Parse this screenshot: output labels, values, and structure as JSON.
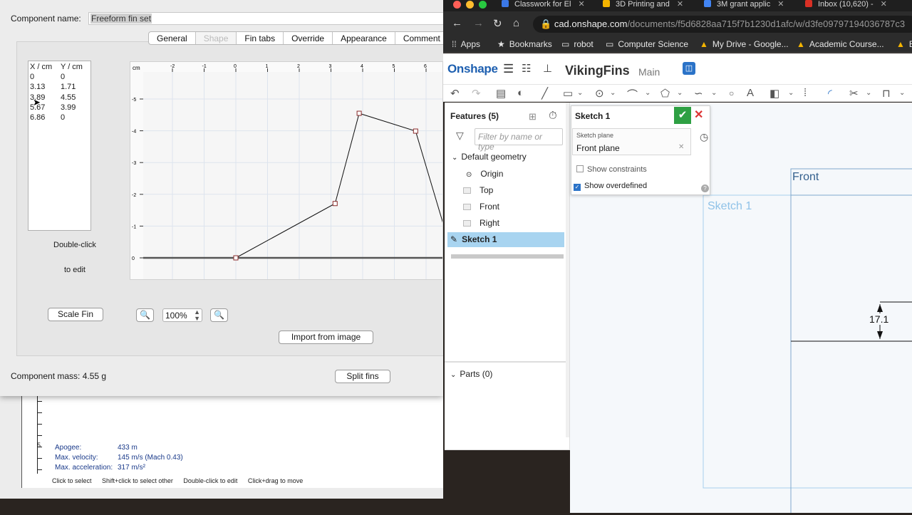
{
  "or_bg": {
    "stats": [
      {
        "label": "Apogee:",
        "value": "433 m"
      },
      {
        "label": "Max. velocity:",
        "value": "145 m/s  (Mach 0.43)"
      },
      {
        "label": "Max. acceleration:",
        "value": "317 m/s²"
      }
    ],
    "ruler_label": "5",
    "status": [
      "Click to select",
      "Shift+click to select other",
      "Double-click to edit",
      "Click+drag to move"
    ]
  },
  "fin_editor": {
    "component_name_label": "Component name:",
    "component_name_value": "Freeform fin set",
    "tabs": [
      "General",
      "Shape",
      "Fin tabs",
      "Override",
      "Appearance",
      "Comment"
    ],
    "selected_tab": "Shape",
    "coords": {
      "headers": [
        "X / cm",
        "Y / cm"
      ],
      "rows": [
        [
          "0",
          "0"
        ],
        [
          "3.13",
          "1.71"
        ],
        [
          "3.89",
          "4.55"
        ],
        [
          "5.67",
          "3.99"
        ],
        [
          "6.86",
          "0"
        ]
      ]
    },
    "double_click_line1": "Double-click",
    "double_click_line2": "to edit",
    "scale_fin_label": "Scale Fin",
    "zoom_value": "100%",
    "import_label": "Import from image",
    "mass_text": "Component mass: 4.55 g",
    "split_label": "Split fins",
    "plot": {
      "unit": "cm",
      "x_ticks": [
        "-2",
        "-1",
        "0",
        "1",
        "2",
        "3",
        "4",
        "5",
        "6"
      ],
      "y_ticks": [
        "-5",
        "-4",
        "-3",
        "-2",
        "-1",
        "0"
      ]
    }
  },
  "chrome": {
    "tabs": [
      "Classwork for El",
      "3D Printing and",
      "3M grant applic",
      "Inbox (10,620) -"
    ],
    "url_main": "cad.onshape.com",
    "url_rest": "/documents/f5d6828aa715f7b1230d1afc/w/d3fe09797194036787c3",
    "bookmarks": [
      "Apps",
      "Bookmarks",
      "robot",
      "Computer Science",
      "My Drive - Google...",
      "Academic Course...",
      "E"
    ]
  },
  "onshape": {
    "logo": "Onshape",
    "doc_title": "VikingFins",
    "branch": "Main",
    "features_title": "Features (5)",
    "filter_placeholder": "Filter by name or type",
    "tree": {
      "group": "Default geometry",
      "origin": "Origin",
      "top": "Top",
      "front": "Front",
      "right": "Right",
      "sketch": "Sketch 1"
    },
    "parts": "Parts (0)",
    "sketch_dialog": {
      "title": "Sketch 1",
      "plane_label": "Sketch plane",
      "plane_value": "Front plane",
      "show_constraints": "Show constraints",
      "show_overdefined": "Show overdefined"
    },
    "canvas": {
      "front_label": "Front",
      "sketch_label": "Sketch 1",
      "dimension": "17.1"
    }
  }
}
